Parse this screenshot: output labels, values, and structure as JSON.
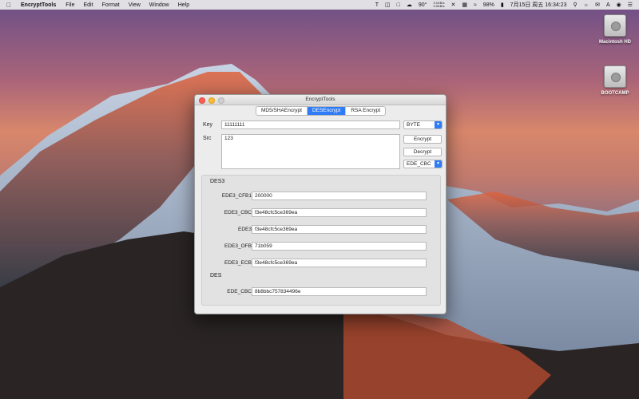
{
  "menubar": {
    "app_name": "EncryptTools",
    "items": [
      "File",
      "Edit",
      "Format",
      "View",
      "Window",
      "Help"
    ],
    "status": {
      "temperature": "90°",
      "net_up": "3.1KB/s",
      "net_down": "0.0KB/s",
      "battery": "98%",
      "datetime": "7月15日 周五 16:34:23"
    }
  },
  "desktop": {
    "icons": [
      {
        "label": "Macintosh HD"
      },
      {
        "label": "BOOTCAMP"
      }
    ]
  },
  "window": {
    "title": "EncryptTools",
    "tabs": [
      {
        "label": "MD5/SHAEncrypt",
        "active": false
      },
      {
        "label": "DESEncrypt",
        "active": true
      },
      {
        "label": "RSA Encrypt",
        "active": false
      }
    ],
    "key_label": "Key",
    "key_value": "11111111",
    "src_label": "Src",
    "src_value": "123",
    "format_select": "BYTE",
    "encrypt_button": "Encrypt",
    "decrypt_button": "Decrypt",
    "mode_select": "EDE_CBC",
    "des3_label": "DES3",
    "des3_rows": [
      {
        "label": "EDE3_CFB1",
        "value": "200000"
      },
      {
        "label": "EDE3_CBC",
        "value": "f3e48cfc5ce369ea"
      },
      {
        "label": "EDE3",
        "value": "f3e48cfc5ce369ea"
      },
      {
        "label": "EDE3_OFB",
        "value": "71b059"
      },
      {
        "label": "EDE3_ECB",
        "value": "f3e48cfc5ce369ea"
      }
    ],
    "des_label": "DES",
    "des_rows": [
      {
        "label": "EDE_CBC",
        "value": "8b8bbc757834496e"
      }
    ]
  },
  "colors": {
    "accent": "#2f7cf6",
    "close": "#fc5f57",
    "minimize": "#fdbc2e"
  }
}
